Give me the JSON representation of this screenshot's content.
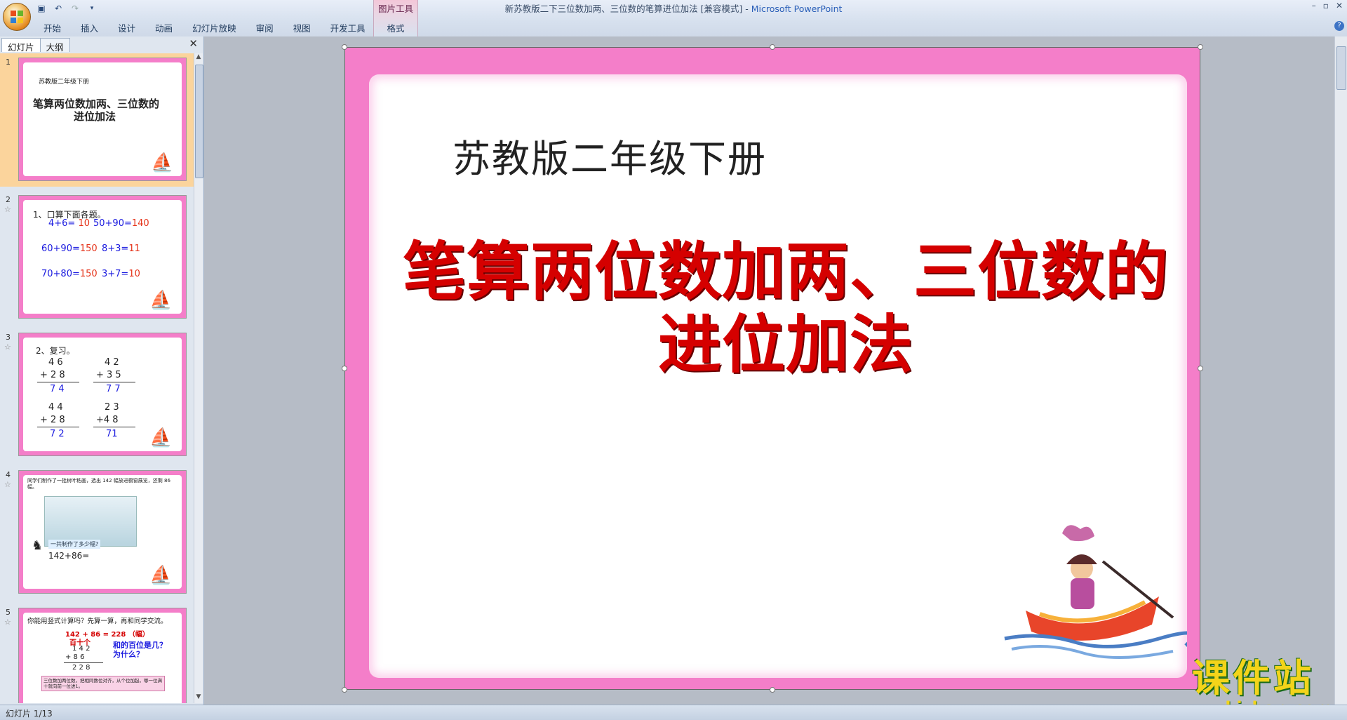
{
  "window": {
    "title": "新苏教版二下三位数加两、三位数的笔算进位加法 [兼容模式] - ",
    "app_name": "Microsoft PowerPoint",
    "controls": [
      "–",
      "▫",
      "✕"
    ]
  },
  "ribbon": {
    "tabs": [
      "开始",
      "插入",
      "设计",
      "动画",
      "幻灯片放映",
      "审阅",
      "视图",
      "开发工具"
    ],
    "context_group": "图片工具",
    "context_tab": "格式"
  },
  "left_pane": {
    "tabs": [
      "幻灯片",
      "大纲"
    ],
    "close": "✕",
    "slides": [
      {
        "number": "1",
        "texts": [
          "苏教版二年级下册",
          "笔算两位数加两、三位数的",
          "进位加法"
        ]
      },
      {
        "number": "2",
        "heading": "1、口算下面各题。",
        "items": [
          {
            "q": "4+6=",
            "a": "10"
          },
          {
            "q": "50+90=",
            "a": "140"
          },
          {
            "q": "60+90=",
            "a": "150"
          },
          {
            "q": "8+3=",
            "a": "11"
          },
          {
            "q": "70+80=",
            "a": "150"
          },
          {
            "q": "3+7=",
            "a": "10"
          }
        ]
      },
      {
        "number": "3",
        "heading": "2、复习。",
        "problems": [
          {
            "top": "4 6",
            "bottom": "+ 2 8",
            "answer": "7 4"
          },
          {
            "top": "4 2",
            "bottom": "+ 3 5",
            "answer": "7 7"
          },
          {
            "top": "4 4",
            "bottom": "+ 2 8",
            "answer": "7 2"
          },
          {
            "top": "2 3",
            "bottom": "+4 8",
            "answer": "71"
          }
        ]
      },
      {
        "number": "4",
        "text": "同学们制作了一批树叶粘画，选出 142 幅放进橱窗展览，还剩 86 幅。",
        "question": "一共制作了多少幅?",
        "equation": "142+86="
      },
      {
        "number": "5",
        "heading": "你能用竖式计算吗？先算一算，再和同学交流。",
        "equation": "142 + 86 = 228 （幅）",
        "place_header": "百十个",
        "line1": "1 4 2",
        "line2": "+   8 6",
        "result": "2 2 8",
        "question": "和的百位是几？为什么？",
        "note": "三位数加两位数，把相同数位对齐，从个位加起，哪一位满十就向前一位进1。"
      }
    ]
  },
  "slide": {
    "subtitle": "苏教版二年级下册",
    "title_line1": "笔算两位数加两、三位数的",
    "title_line2": "进位加法",
    "watermark_title": "课件站",
    "watermark_url": "www.kjzhan.com",
    "colors": {
      "border": "#f47ec9",
      "title": "#d50000",
      "watermark": "#f3d41a"
    }
  },
  "status": {
    "slide_indicator": "幻灯片 1/13"
  }
}
